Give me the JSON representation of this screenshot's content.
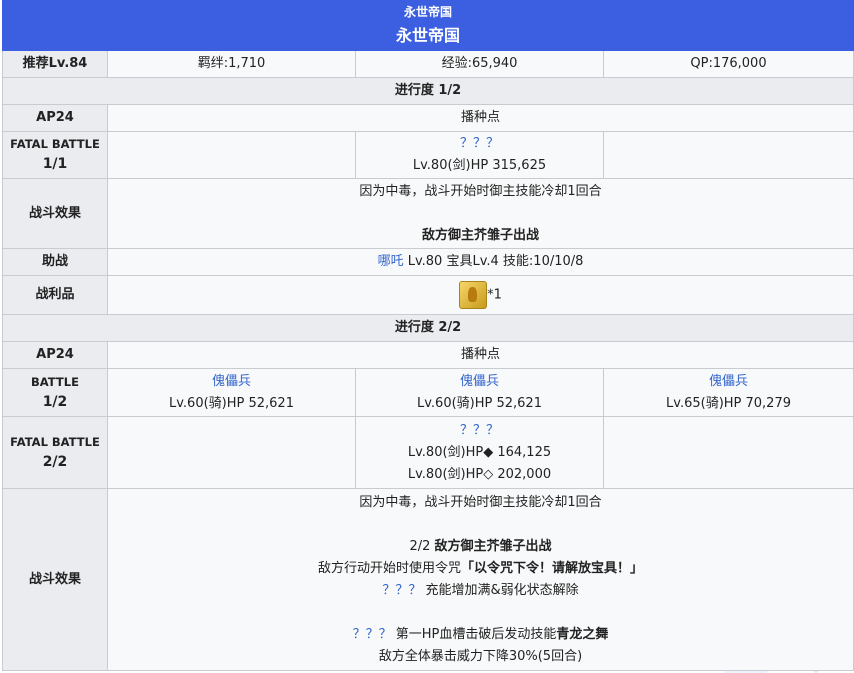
{
  "header": {
    "subtitle": "永世帝国",
    "title": "永世帝国"
  },
  "summary": {
    "recommend": "推荐Lv.84",
    "bond": "羁绊:1,710",
    "exp": "经验:65,940",
    "qp": "QP:176,000"
  },
  "stage1": {
    "progress": "进行度 1/2",
    "ap_label": "AP24",
    "ap_value": "播种点",
    "battle_title": "FATAL BATTLE",
    "battle_num": "1/1",
    "enemy_name": "？？？",
    "enemy_stats": "Lv.80(剑)HP 315,625",
    "effect_label": "战斗效果",
    "effect_line1": "因为中毒，战斗开始时御主技能冷却1回合",
    "effect_line2": "敌方御主芥雏子出战",
    "support_label": "助战",
    "support_name": "哪吒",
    "support_detail": " Lv.80 宝具Lv.4 技能:10/10/8",
    "drop_label": "战利品",
    "drop_count": "*1",
    "drop_icon": "golden-statue-icon"
  },
  "stage2": {
    "progress": "进行度 2/2",
    "ap_label": "AP24",
    "ap_value": "播种点",
    "battle1_title": "BATTLE",
    "battle1_num": "1/2",
    "enemies1": [
      {
        "name": "傀儡兵",
        "stats": "Lv.60(骑)HP 52,621"
      },
      {
        "name": "傀儡兵",
        "stats": "Lv.60(骑)HP 52,621"
      },
      {
        "name": "傀儡兵",
        "stats": "Lv.65(骑)HP 70,279"
      }
    ],
    "battle2_title": "FATAL BATTLE",
    "battle2_num": "2/2",
    "enemy2_name": "？？？",
    "enemy2_stats1": "Lv.80(剑)HP◆ 164,125",
    "enemy2_stats2": "Lv.80(剑)HP◇ 202,000",
    "effect_label": "战斗效果",
    "effect_line1": "因为中毒，战斗开始时御主技能冷却1回合",
    "effect_line2_pre": "2/2 ",
    "effect_line2_bold": "敌方御主芥雏子出战",
    "effect_line3_pre": "敌方行动开始时使用令咒",
    "effect_line3_bold": "「以令咒下令！请解放宝具！」",
    "effect_line4_link": "？？？",
    "effect_line4_text": " 充能增加满&弱化状态解除",
    "effect_line5_link": "？？？",
    "effect_line5_text": " 第一HP血槽击破后发动技能",
    "effect_line5_bold": "青龙之舞",
    "effect_line6": "敌方全体暴击威力下降30%(5回合)"
  }
}
